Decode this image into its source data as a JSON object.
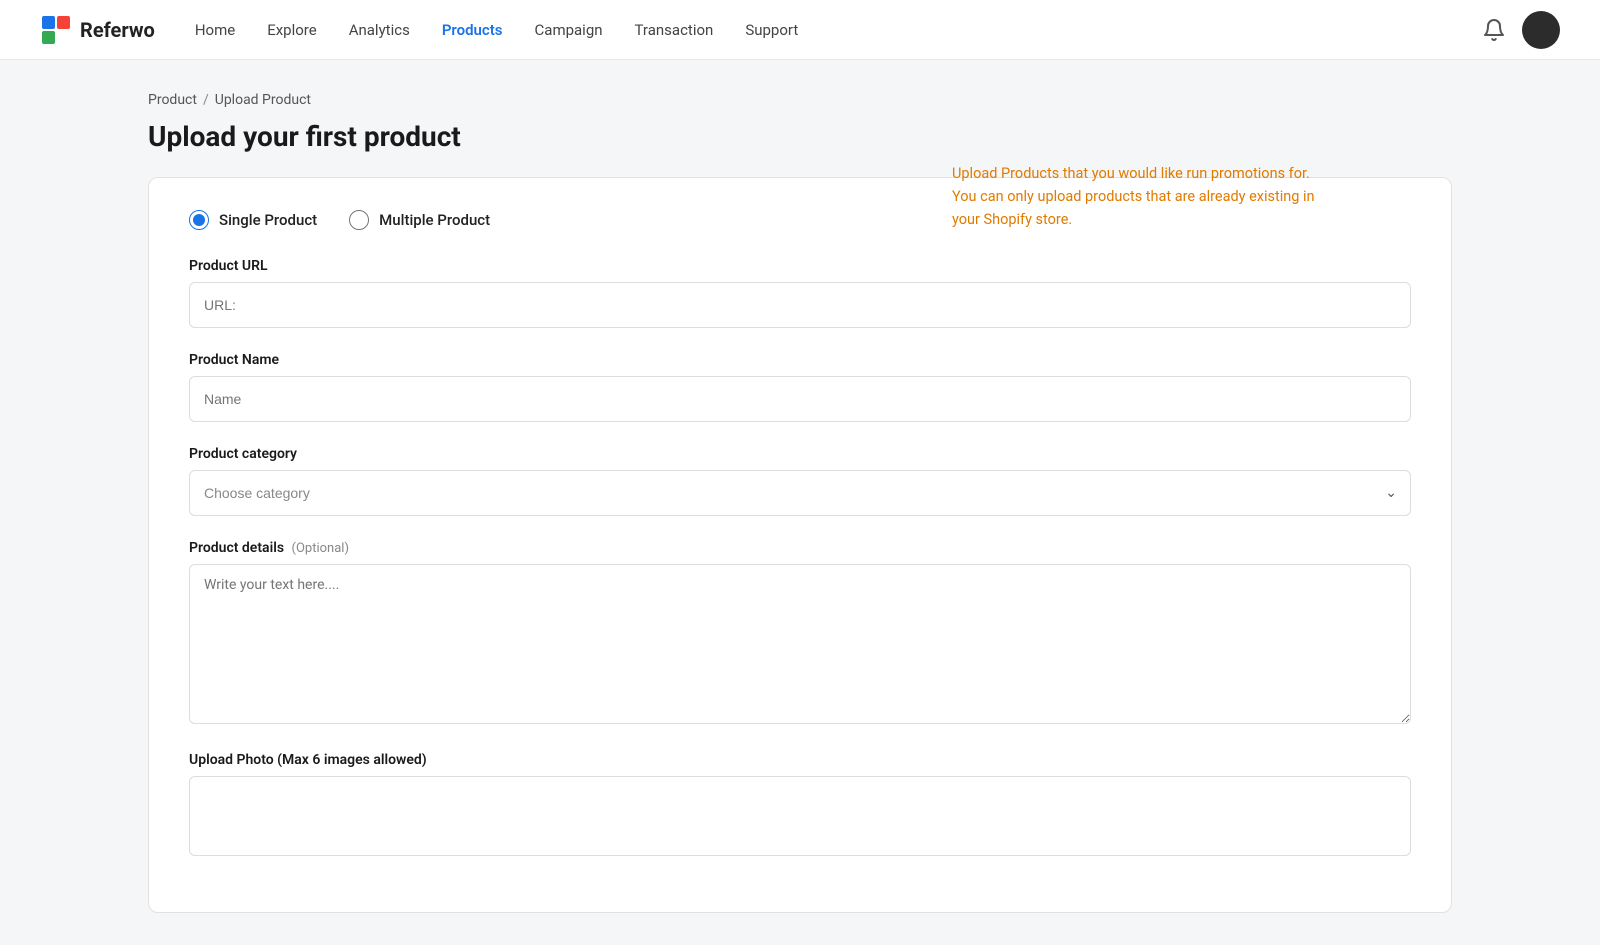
{
  "nav": {
    "logo_text": "Referwo",
    "links": [
      {
        "label": "Home",
        "active": false,
        "id": "home"
      },
      {
        "label": "Explore",
        "active": false,
        "id": "explore"
      },
      {
        "label": "Analytics",
        "active": false,
        "id": "analytics"
      },
      {
        "label": "Products",
        "active": true,
        "id": "products"
      },
      {
        "label": "Campaign",
        "active": false,
        "id": "campaign"
      },
      {
        "label": "Transaction",
        "active": false,
        "id": "transaction"
      },
      {
        "label": "Support",
        "active": false,
        "id": "support"
      }
    ]
  },
  "breadcrumb": {
    "parent": "Product",
    "separator": "/",
    "current": "Upload Product"
  },
  "page": {
    "title": "Upload your first product",
    "info_message": "Upload Products that you would like run promotions for. You can only upload products that are already existing in your Shopify store."
  },
  "form": {
    "single_product_label": "Single Product",
    "multiple_product_label": "Multiple Product",
    "product_url_label": "Product URL",
    "product_url_placeholder": "URL:",
    "product_name_label": "Product Name",
    "product_name_placeholder": "Name",
    "product_category_label": "Product category",
    "product_category_placeholder": "Choose category",
    "product_details_label": "Product details",
    "product_details_optional": "(Optional)",
    "product_details_placeholder": "Write your text here....",
    "upload_photo_label": "Upload Photo (Max 6 images allowed)"
  },
  "colors": {
    "accent_blue": "#1a73e8",
    "info_orange": "#e07b00"
  }
}
